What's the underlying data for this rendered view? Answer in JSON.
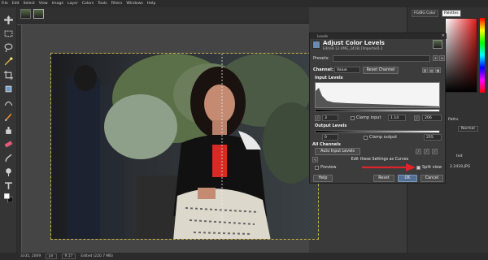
{
  "menubar": {
    "items": [
      "File",
      "Edit",
      "Select",
      "View",
      "Image",
      "Layer",
      "Colors",
      "Tools",
      "Filters",
      "Windows",
      "Help"
    ]
  },
  "statusbar": {
    "coords": "3335, 2009",
    "unit": "px",
    "zoom": "9.17",
    "message": "Edited (220.7 MB)"
  },
  "right_dock": {
    "tab1": "FG/BG Color",
    "tab2": "Palettes",
    "patterns_tab": "Paths",
    "mode": "Normal",
    "filename": "2.2418.JPG",
    "hex_label": "ted"
  },
  "dialog": {
    "window_title": "Levels",
    "heading": "Adjust Color Levels",
    "subtitle": "Edited-13 (IMG_2418) [Imported]-1",
    "presets_label": "Presets:",
    "channel_label": "Channel:",
    "channel_value": "Value",
    "reset_channel": "Reset Channel",
    "input_levels_label": "Input Levels",
    "input_low": "3",
    "clamp_input_label": "Clamp input",
    "gamma": "1.14",
    "input_high": "206",
    "output_levels_label": "Output Levels",
    "output_low": "0",
    "clamp_output_label": "Clamp output",
    "output_high": "255",
    "all_channels_label": "All Channels",
    "auto_input_levels": "Auto Input Levels",
    "edit_curves": "Edit these Settings as Curves",
    "preview_label": "Preview",
    "split_view_label": "Split view",
    "help_button": "Help",
    "reset_button": "Reset",
    "ok_button": "OK",
    "cancel_button": "Cancel"
  },
  "colors": {
    "accent_button": "#536f94",
    "arrow": "#e0232a",
    "fg_color": "#e51919"
  }
}
